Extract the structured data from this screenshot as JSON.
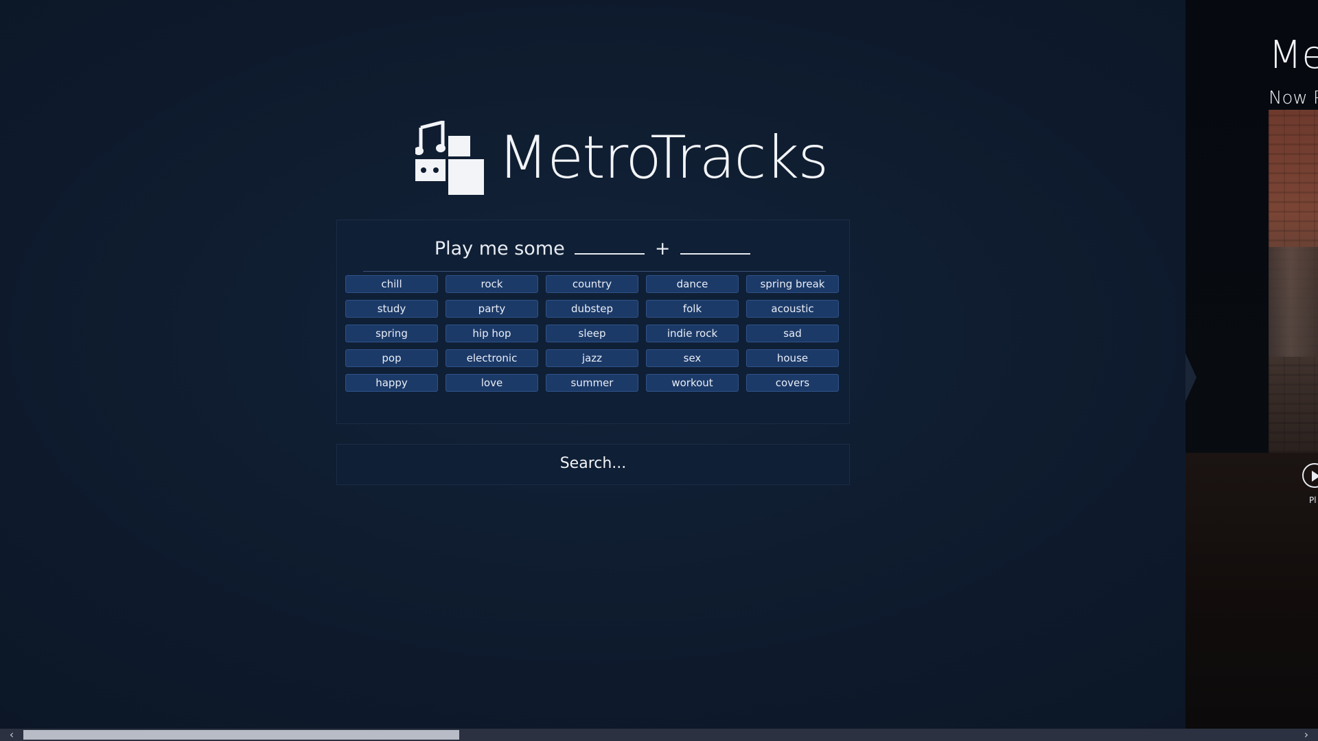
{
  "app": {
    "title": "MetroTracks",
    "logo_icon": "music-note-blocks-icon"
  },
  "tag_panel": {
    "prompt_text": "Play me some",
    "prompt_plus": "+",
    "tags": [
      "chill",
      "rock",
      "country",
      "dance",
      "spring break",
      "study",
      "party",
      "dubstep",
      "folk",
      "acoustic",
      "spring",
      "hip hop",
      "sleep",
      "indie rock",
      "sad",
      "pop",
      "electronic",
      "jazz",
      "sex",
      "house",
      "happy",
      "love",
      "summer",
      "workout",
      "covers"
    ]
  },
  "search": {
    "label": "Search..."
  },
  "right_panel": {
    "title": "Me",
    "now_playing": "Now P",
    "play_label": "Pl"
  },
  "scrollbar": {
    "left_arrow": "‹",
    "right_arrow": "›"
  },
  "colors": {
    "background": "#0f1c2f",
    "tag_fill": "#1c3a68",
    "panel": "#0f1f35"
  }
}
